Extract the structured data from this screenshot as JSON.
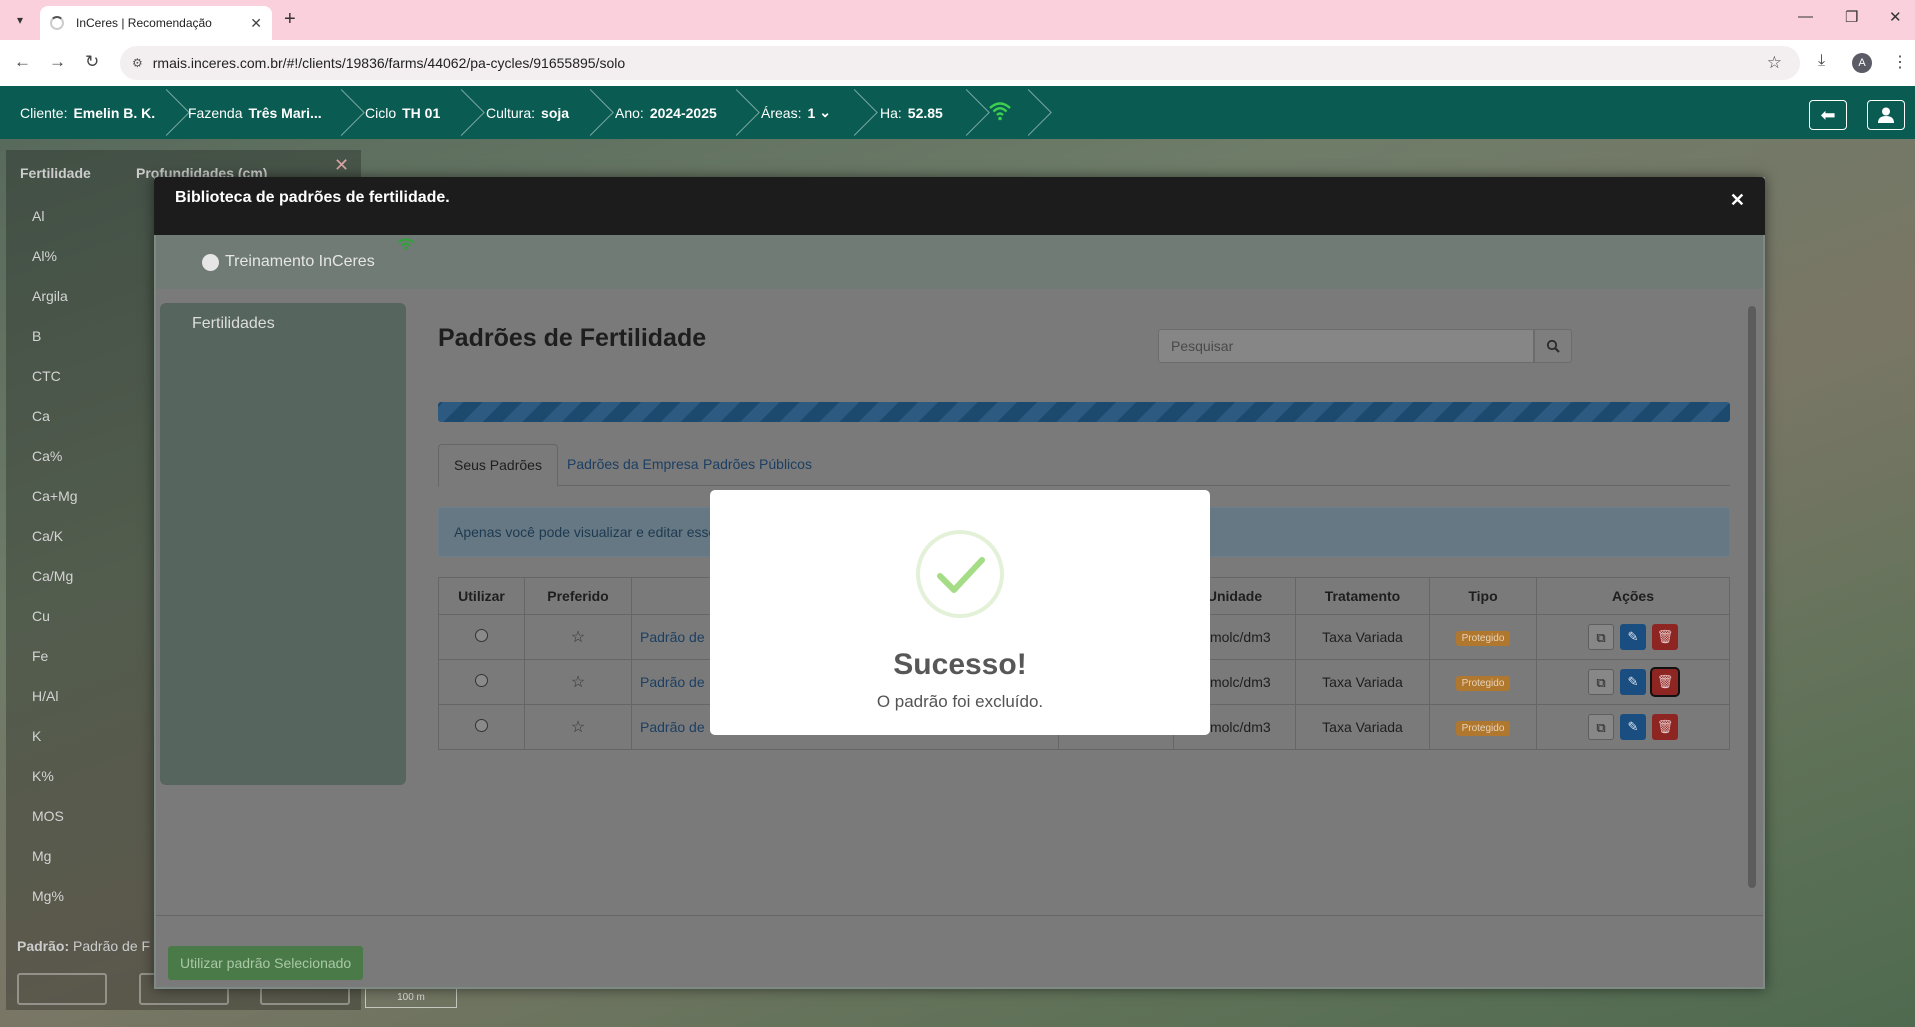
{
  "browser": {
    "tab_title": "InCeres | Recomendação",
    "url": "rmais.inceres.com.br/#!/clients/19836/farms/44062/pa-cycles/91655895/solo",
    "profile_initial": "A"
  },
  "header": {
    "cliente_label": "Cliente:",
    "cliente_value": "Emelin B. K.",
    "fazenda_label": "Fazenda",
    "fazenda_value": "Três Mari...",
    "ciclo_label": "Ciclo",
    "ciclo_value": "TH 01",
    "cultura_label": "Cultura:",
    "cultura_value": "soja",
    "ano_label": "Ano:",
    "ano_value": "2024-2025",
    "areas_label": "Áreas:",
    "areas_value": "1",
    "ha_label": "Ha:",
    "ha_value": "52.85"
  },
  "side_panel": {
    "tab1": "Fertilidade",
    "tab2": "Profundidades (cm)",
    "rows": [
      "Al",
      "Al%",
      "Argila",
      "B",
      "CTC",
      "Ca",
      "Ca%",
      "Ca+Mg",
      "Ca/K",
      "Ca/Mg",
      "Cu",
      "Fe",
      "H/Al",
      "K",
      "K%",
      "MOS",
      "Mg",
      "Mg%"
    ],
    "padrao_label": "Padrão:",
    "padrao_value": "Padrão de F",
    "scale_label": "100 m"
  },
  "library": {
    "title": "Biblioteca de padrões de fertilidade.",
    "user": "Treinamento InCeres",
    "left_item": "Fertilidades",
    "page_title": "Padrões de Fertilidade",
    "search_placeholder": "Pesquisar",
    "tabs": [
      "Seus Padrões",
      "Padrões da Empresa",
      "Padrões Públicos"
    ],
    "info_text": "Apenas você pode visualizar e editar esse",
    "columns": {
      "utilizar": "Utilizar",
      "preferido": "Preferido",
      "unidade": "Unidade",
      "tratamento": "Tratamento",
      "tipo": "Tipo",
      "acoes": "Ações"
    },
    "rows": [
      {
        "name": "Padrão de",
        "unidade": "mmolc/dm3",
        "tratamento": "Taxa Variada",
        "tipo": "Protegido"
      },
      {
        "name": "Padrão de",
        "unidade": "mmolc/dm3",
        "tratamento": "Taxa Variada",
        "tipo": "Protegido"
      },
      {
        "name": "Padrão de",
        "unidade": "mmolc/dm3",
        "tratamento": "Taxa Variada",
        "tipo": "Protegido"
      }
    ],
    "use_button": "Utilizar padrão Selecionado"
  },
  "alert": {
    "title": "Sucesso!",
    "text": "O padrão foi excluído."
  },
  "colors": {
    "header_bg": "#0a5c52",
    "success_green": "#a5dc86",
    "badge_orange": "#b0772e"
  }
}
